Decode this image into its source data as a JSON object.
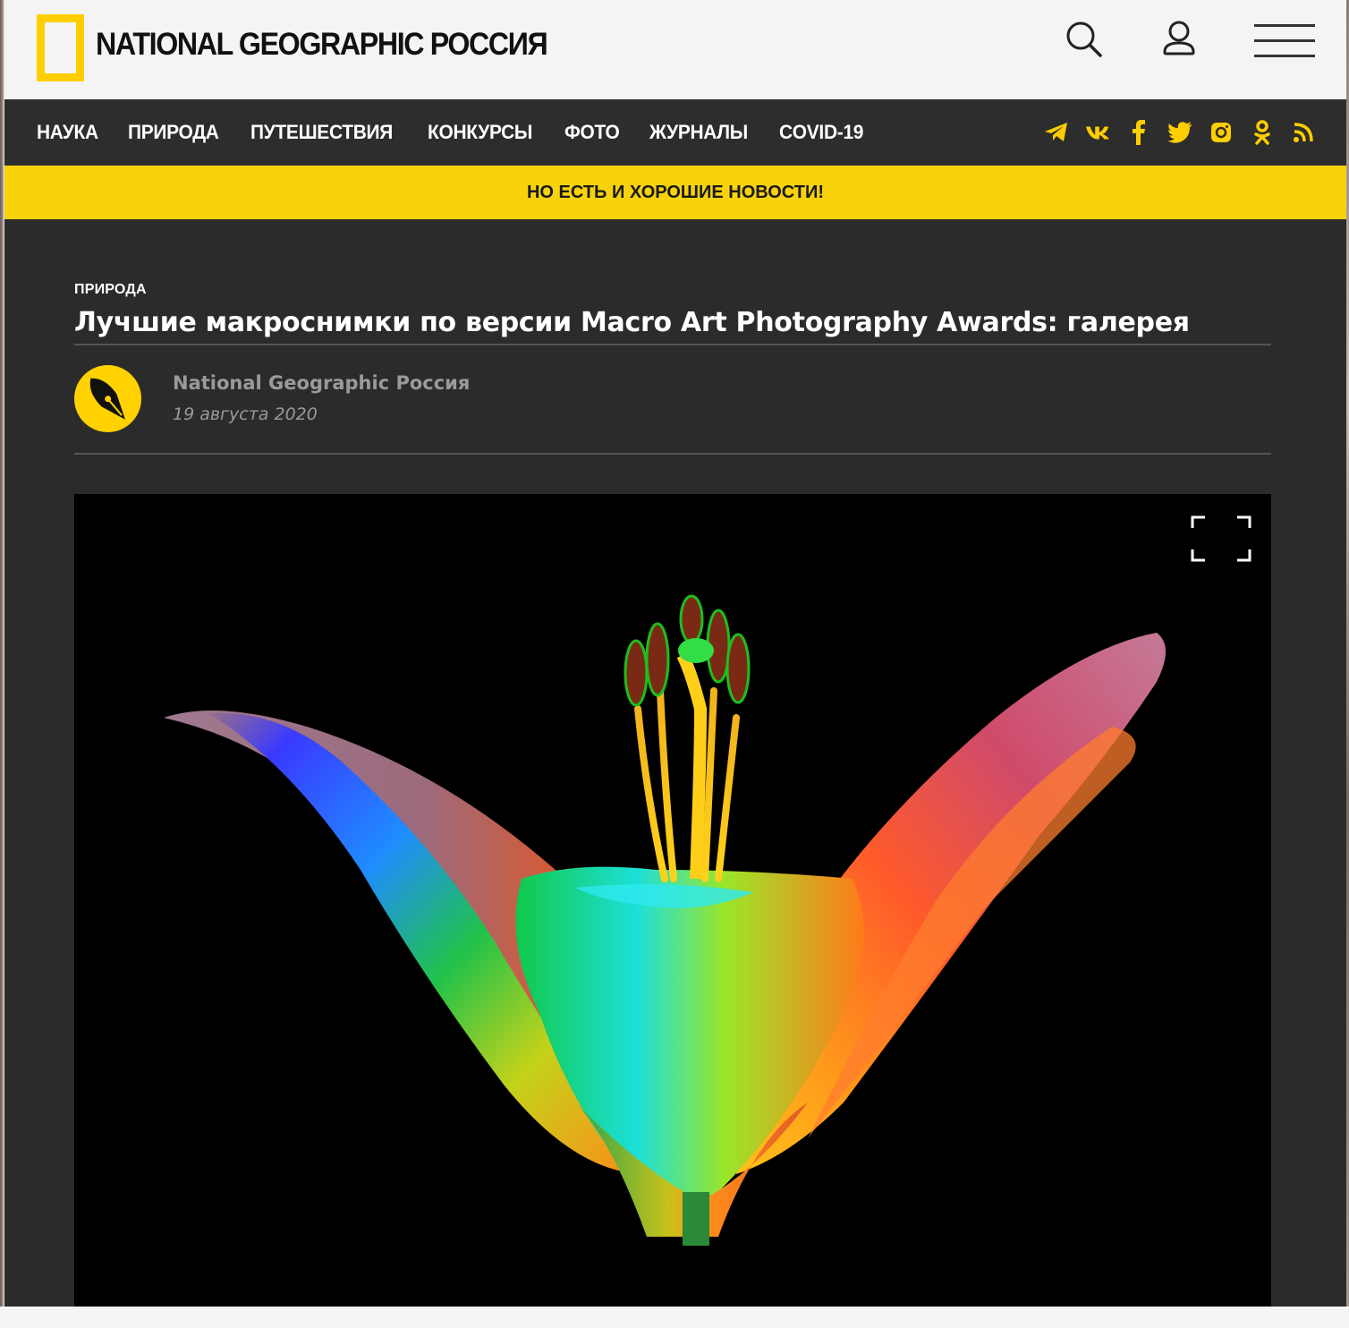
{
  "header": {
    "logo_text": "NATIONAL GEOGRAPHIC РОССИЯ",
    "brand_color": "#ffce00",
    "icons": [
      "search-icon",
      "user-icon",
      "hamburger-menu-icon"
    ]
  },
  "nav": {
    "items": [
      {
        "label": "НАУКА"
      },
      {
        "label": "ПРИРОДА"
      },
      {
        "label": "ПУТЕШЕСТВИЯ"
      },
      {
        "label": "КОНКУРСЫ"
      },
      {
        "label": "ФОТО"
      },
      {
        "label": "ЖУРНАЛЫ"
      },
      {
        "label": "COVID-19"
      }
    ],
    "social_icons": [
      "telegram-icon",
      "vk-icon",
      "facebook-icon",
      "twitter-icon",
      "instagram-icon",
      "odnoklassniki-icon",
      "rss-icon"
    ],
    "social_color": "#ffce00"
  },
  "banner": {
    "text": "НО ЕСТЬ И ХОРОШИЕ НОВОСТИ!",
    "color": "#f8d20b"
  },
  "article": {
    "category": "ПРИРОДА",
    "title": "Лучшие макроснимки по версии Macro Art Photography Awards: галерея",
    "author": "National Geographic Россия",
    "date": "19 августа 2020"
  },
  "gallery": {
    "image_icon": "rainbow-lily-photo",
    "fullscreen_icon": "fullscreen-icon"
  }
}
